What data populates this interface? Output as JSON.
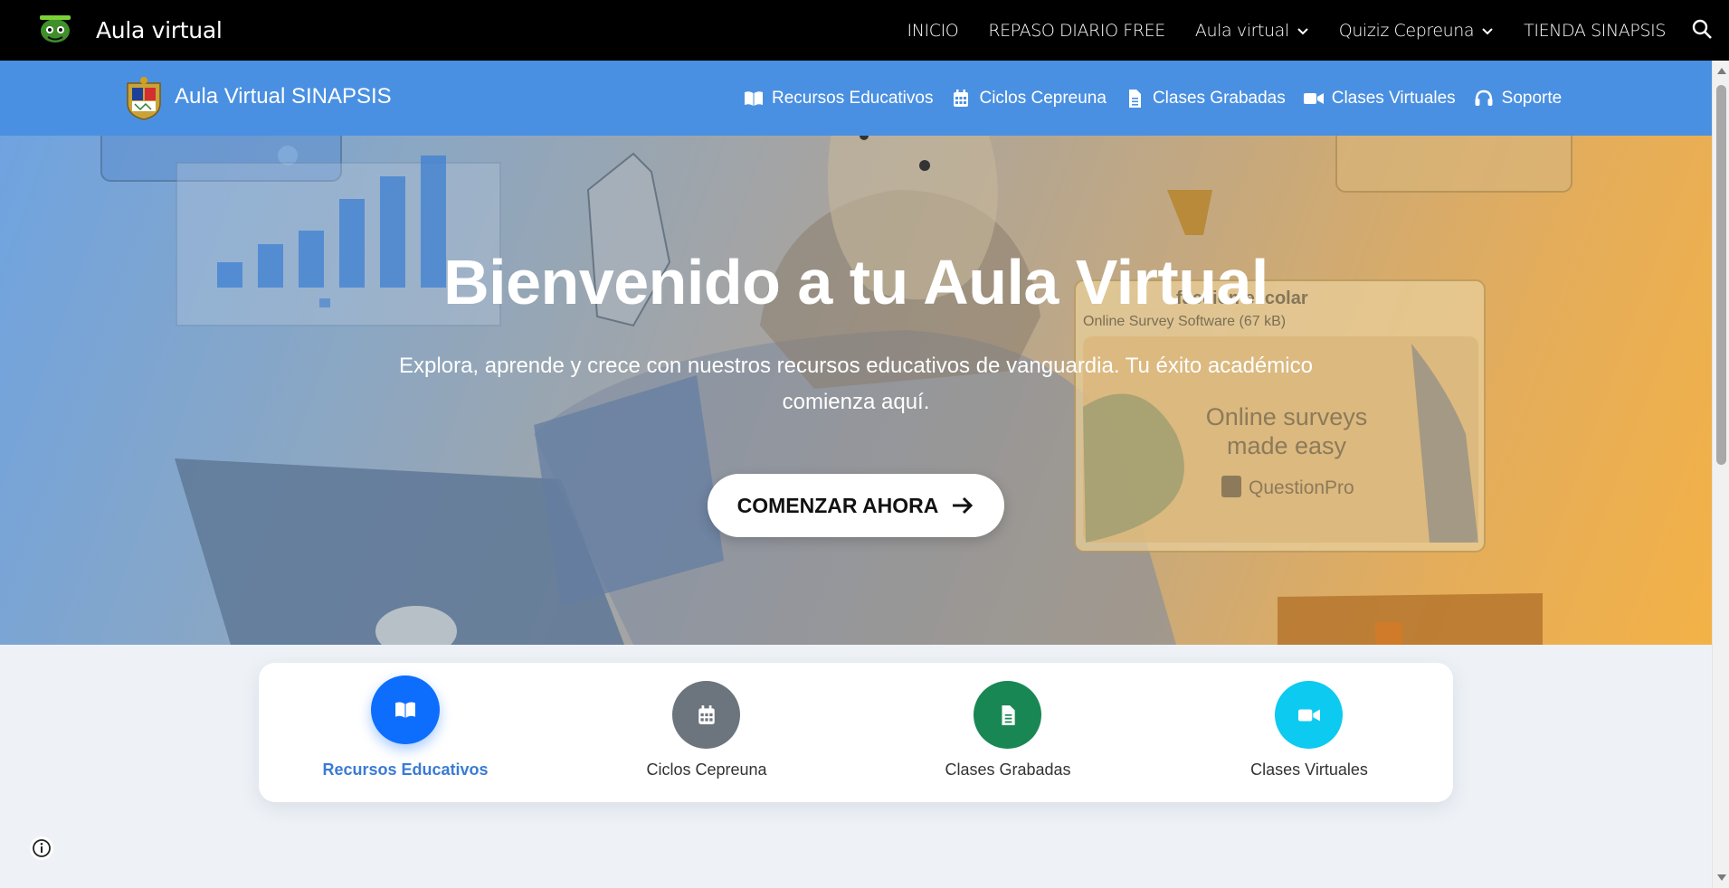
{
  "topbar": {
    "title": "Aula virtual",
    "nav": [
      {
        "label": "INICIO",
        "has_dropdown": false
      },
      {
        "label": "REPASO DIARIO FREE",
        "has_dropdown": false
      },
      {
        "label": "Aula virtual",
        "has_dropdown": true
      },
      {
        "label": "Quiziz Cepreuna",
        "has_dropdown": true
      },
      {
        "label": "TIENDA SINAPSIS",
        "has_dropdown": false
      }
    ]
  },
  "bluenav": {
    "brand": "Aula Virtual SINAPSIS",
    "items": [
      {
        "label": "Recursos Educativos",
        "icon": "book-open-icon"
      },
      {
        "label": "Ciclos Cepreuna",
        "icon": "calendar-icon"
      },
      {
        "label": "Clases Grabadas",
        "icon": "file-icon"
      },
      {
        "label": "Clases Virtuales",
        "icon": "video-icon"
      },
      {
        "label": "Soporte",
        "icon": "headset-icon"
      }
    ]
  },
  "hero": {
    "title": "Bienvenido a tu Aula Virtual",
    "subtitle": "Explora, aprende y crece con nuestros recursos educativos de vanguardia. Tu éxito académico comienza aquí.",
    "cta": "COMENZAR AHORA",
    "illustration_text": {
      "survey_title": "faccion escolar",
      "survey_file": "Online Survey Software (67 kB)",
      "survey_tagline_1": "Online surveys",
      "survey_tagline_2": "made easy",
      "survey_brand": "QuestionPro"
    }
  },
  "features": [
    {
      "label": "Recursos Educativos",
      "color": "#0d6efd",
      "icon": "book-open-icon",
      "active": true
    },
    {
      "label": "Ciclos Cepreuna",
      "color": "#6c757d",
      "icon": "calendar-icon",
      "active": false
    },
    {
      "label": "Clases Grabadas",
      "color": "#198754",
      "icon": "file-icon",
      "active": false
    },
    {
      "label": "Clases Virtuales",
      "color": "#0dcaf0",
      "icon": "video-icon",
      "active": false
    }
  ],
  "colors": {
    "topbar_bg": "#000000",
    "bluenav_bg": "#4a90e2",
    "page_bg": "#eef2f7",
    "hero_gradient_start": "#6fa3e0",
    "hero_gradient_end": "#f3b247"
  }
}
